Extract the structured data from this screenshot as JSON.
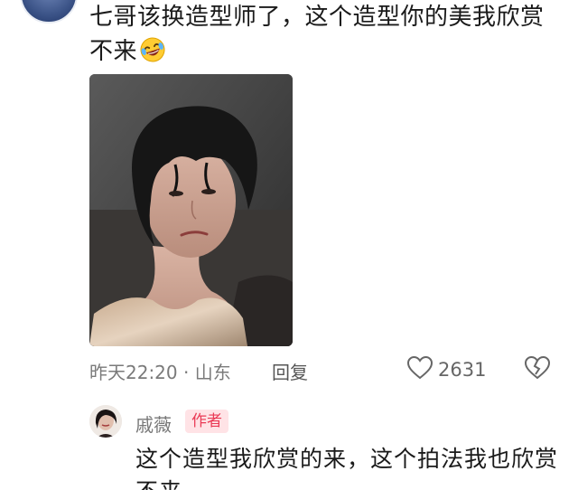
{
  "comment": {
    "text": "七哥该换造型师了，这个造型你的美我欣赏不来",
    "emoji": "laughing-crying-emoji",
    "time_location": "昨天22:20 · 山东",
    "reply_label": "回复",
    "like_count": "2631"
  },
  "reply": {
    "author_name": "戚薇",
    "author_badge": "作者",
    "text": "这个造型我欣赏的来，这个拍法我也欣赏不来"
  },
  "colors": {
    "badge_bg": "#ffe3e6",
    "badge_text": "#ea3a55",
    "meta_text": "#7a7a7a"
  }
}
